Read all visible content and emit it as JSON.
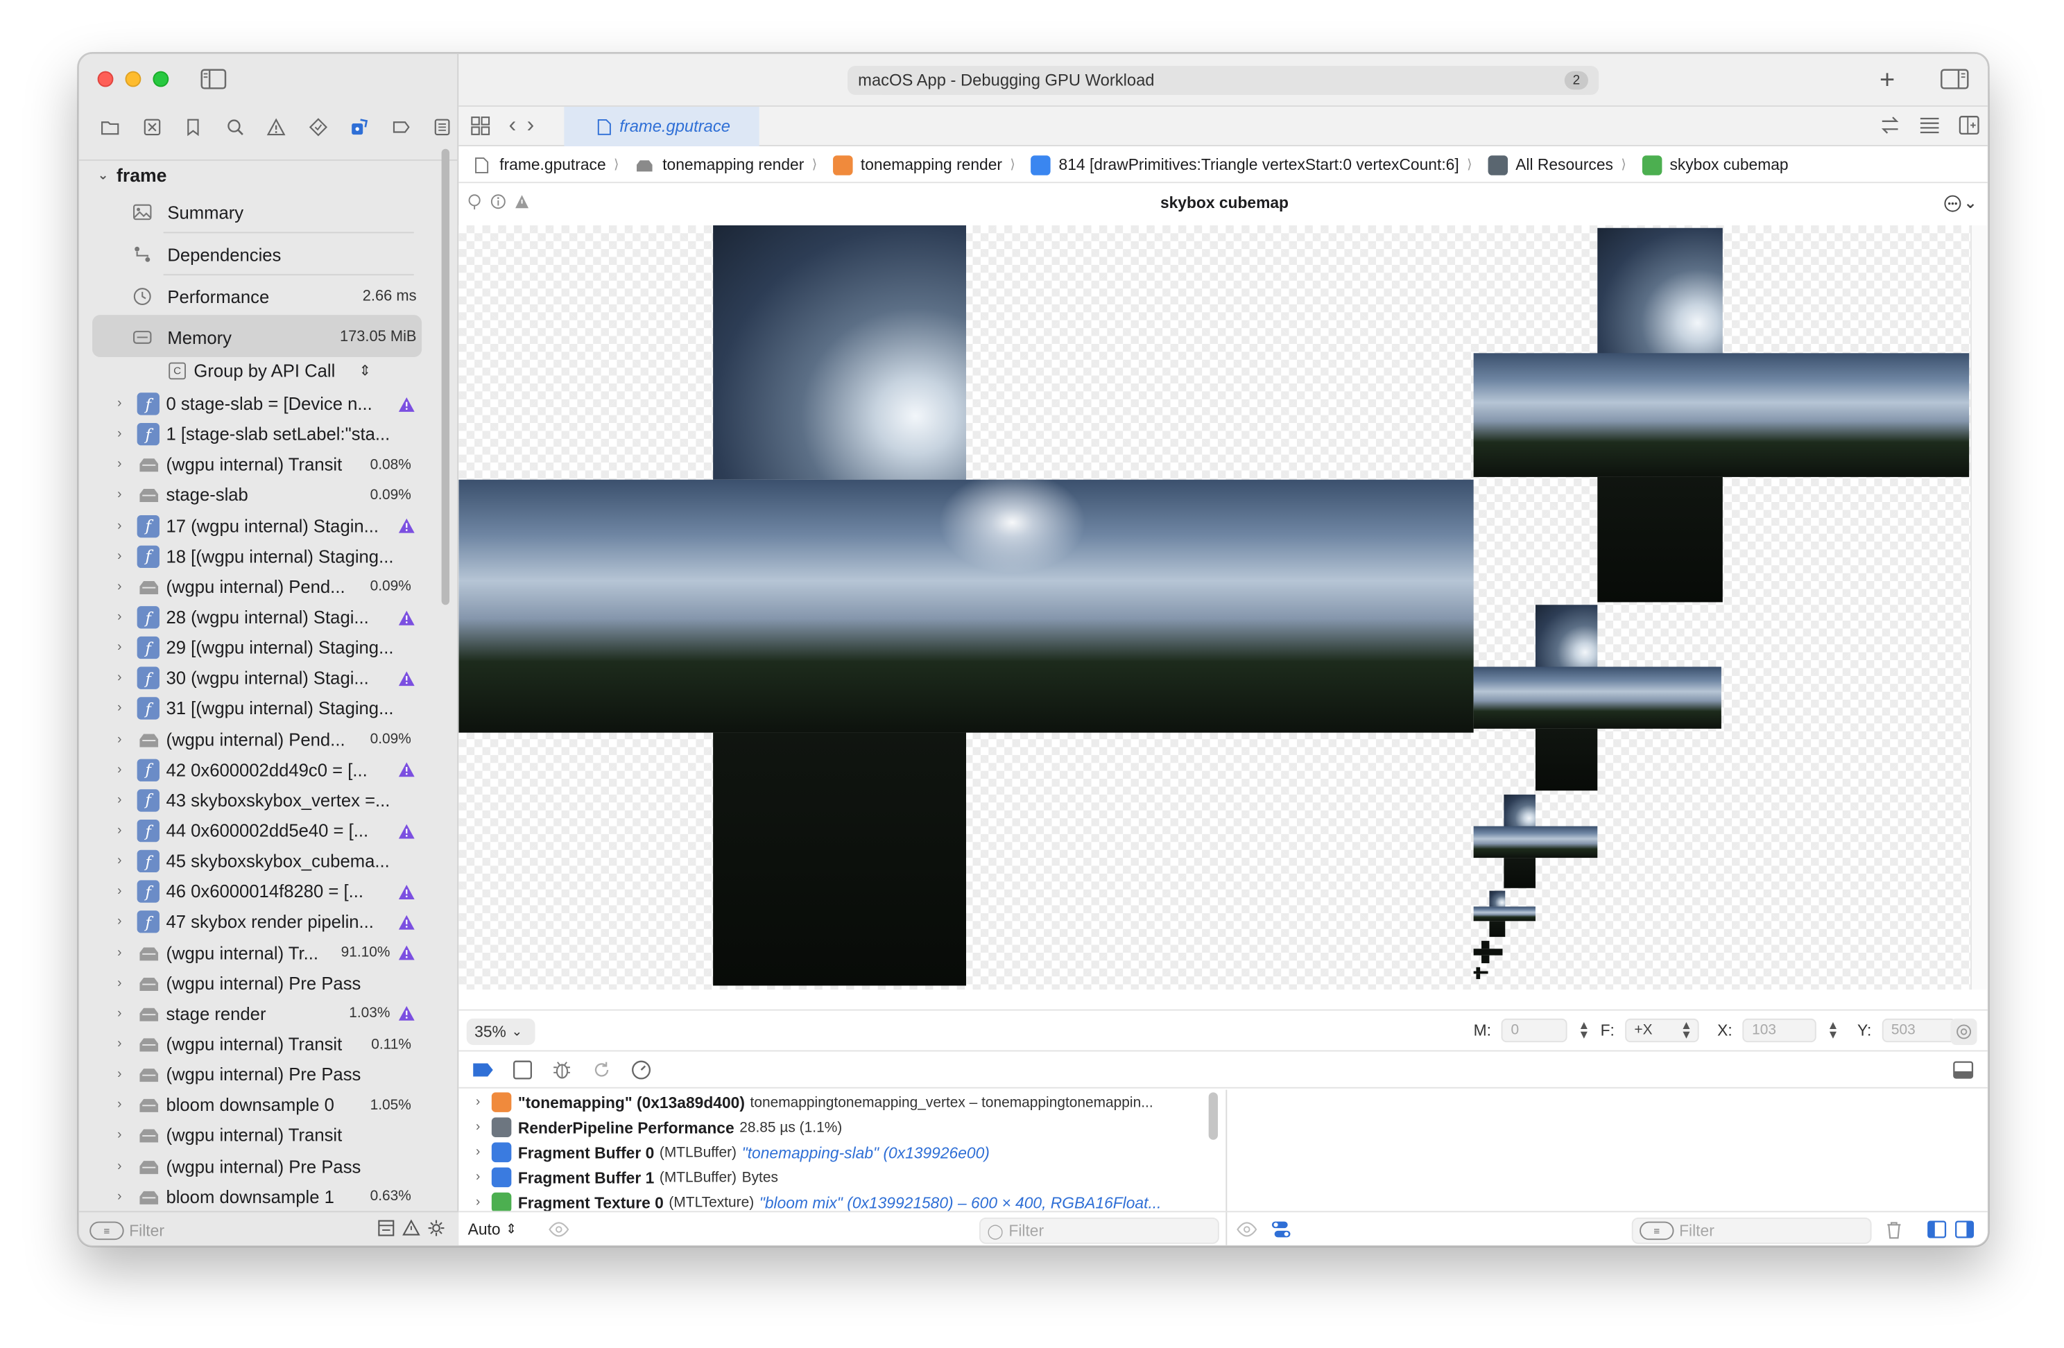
{
  "window": {
    "title": "macOS App - Debugging GPU Workload",
    "title_badge": "2"
  },
  "sidebar": {
    "root_label": "frame",
    "summary_items": [
      {
        "label": "Summary",
        "value": "",
        "icon": "photo-icon"
      },
      {
        "label": "Dependencies",
        "value": "",
        "icon": "dependencies-icon"
      },
      {
        "label": "Performance",
        "value": "2.66 ms",
        "icon": "clock-icon"
      },
      {
        "label": "Memory",
        "value": "173.05 MiB",
        "icon": "memory-icon"
      }
    ],
    "group_by": "Group by API Call",
    "group_box_letter": "C",
    "calls": [
      {
        "label": "0 stage-slab = [Device n...",
        "kind": "fn",
        "pct": "",
        "warn": true
      },
      {
        "label": "1 [stage-slab setLabel:\"sta...",
        "kind": "fn",
        "pct": "",
        "warn": false
      },
      {
        "label": "(wgpu internal) Transit",
        "kind": "enc",
        "pct": "0.08%",
        "warn": false
      },
      {
        "label": "stage-slab",
        "kind": "enc",
        "pct": "0.09%",
        "warn": false
      },
      {
        "label": "17 (wgpu internal) Stagin...",
        "kind": "fn",
        "pct": "",
        "warn": true
      },
      {
        "label": "18 [(wgpu internal) Staging...",
        "kind": "fn",
        "pct": "",
        "warn": false
      },
      {
        "label": "(wgpu internal) Pend...",
        "kind": "enc",
        "pct": "0.09%",
        "warn": false
      },
      {
        "label": "28 (wgpu internal) Stagi...",
        "kind": "fn",
        "pct": "",
        "warn": true
      },
      {
        "label": "29 [(wgpu internal) Staging...",
        "kind": "fn",
        "pct": "",
        "warn": false
      },
      {
        "label": "30 (wgpu internal) Stagi...",
        "kind": "fn",
        "pct": "",
        "warn": true
      },
      {
        "label": "31 [(wgpu internal) Staging...",
        "kind": "fn",
        "pct": "",
        "warn": false
      },
      {
        "label": "(wgpu internal) Pend...",
        "kind": "enc",
        "pct": "0.09%",
        "warn": false
      },
      {
        "label": "42 0x600002dd49c0 = [...",
        "kind": "fn",
        "pct": "",
        "warn": true
      },
      {
        "label": "43 skyboxskybox_vertex =...",
        "kind": "fn",
        "pct": "",
        "warn": false
      },
      {
        "label": "44 0x600002dd5e40 = [...",
        "kind": "fn",
        "pct": "",
        "warn": true
      },
      {
        "label": "45 skyboxskybox_cubema...",
        "kind": "fn",
        "pct": "",
        "warn": false
      },
      {
        "label": "46 0x6000014f8280 = [...",
        "kind": "fn",
        "pct": "",
        "warn": true
      },
      {
        "label": "47 skybox render pipelin...",
        "kind": "fn",
        "pct": "",
        "warn": true
      },
      {
        "label": "(wgpu internal) Tr...",
        "kind": "enc",
        "pct": "91.10%",
        "warn": true
      },
      {
        "label": "(wgpu internal) Pre Pass",
        "kind": "enc",
        "pct": "",
        "warn": false
      },
      {
        "label": "stage render",
        "kind": "enc",
        "pct": "1.03%",
        "warn": true
      },
      {
        "label": "(wgpu internal) Transit",
        "kind": "enc",
        "pct": "0.11%",
        "warn": false
      },
      {
        "label": "(wgpu internal) Pre Pass",
        "kind": "enc",
        "pct": "",
        "warn": false
      },
      {
        "label": "bloom downsample 0",
        "kind": "enc",
        "pct": "1.05%",
        "warn": false
      },
      {
        "label": "(wgpu internal) Transit",
        "kind": "enc",
        "pct": "",
        "warn": false
      },
      {
        "label": "(wgpu internal) Pre Pass",
        "kind": "enc",
        "pct": "",
        "warn": false
      },
      {
        "label": "bloom downsample 1",
        "kind": "enc",
        "pct": "0.63%",
        "warn": false
      }
    ],
    "filter_placeholder": "Filter"
  },
  "tabs": {
    "active_label": "frame.gputrace"
  },
  "jumpbar": [
    {
      "label": "frame.gputrace",
      "icon": "document-icon",
      "color": "#777777"
    },
    {
      "label": "tonemapping render",
      "icon": "encoder-icon",
      "color": "#8a8a8a"
    },
    {
      "label": "tonemapping render",
      "icon": "render-pass-icon",
      "color": "#f08a3c"
    },
    {
      "label": "814 [drawPrimitives:Triangle vertexStart:0 vertexCount:6]",
      "icon": "draw-call-icon",
      "color": "#3a86f0"
    },
    {
      "label": "All Resources",
      "icon": "resources-icon",
      "color": "#5a6670"
    },
    {
      "label": "skybox cubemap",
      "icon": "texture-icon",
      "color": "#4caf50"
    }
  ],
  "viewer": {
    "title": "skybox cubemap",
    "zoom": "35%",
    "fields": {
      "m_label": "M:",
      "m_value": "0",
      "f_label": "F:",
      "f_value": "+X",
      "x_label": "X:",
      "x_value": "103",
      "y_label": "Y:",
      "y_value": "503"
    }
  },
  "bindings": [
    {
      "title": "\"tonemapping\" (0x13a89d400)",
      "type": "tonemappingtonemapping_vertex – tonemappingtonemappin...",
      "link": "",
      "extra": "",
      "icon_color": "#f08a3c"
    },
    {
      "title": "RenderPipeline Performance",
      "type": "28.85 µs (1.1%)",
      "link": "",
      "extra": "",
      "icon_color": "#6d7680"
    },
    {
      "title": "Fragment Buffer 0",
      "type": "(MTLBuffer)",
      "link": "\"tonemapping-slab\" (0x139926e00)",
      "extra": "",
      "icon_color": "#3a7be0"
    },
    {
      "title": "Fragment Buffer 1",
      "type": "(MTLBuffer)",
      "link": "",
      "extra": "Bytes",
      "icon_color": "#3a7be0"
    },
    {
      "title": "Fragment Texture 0",
      "type": "(MTLTexture)",
      "link": "\"bloom mix\" (0x139921580) – 600 × 400, RGBA16Float...",
      "extra": "",
      "icon_color": "#4caf50"
    }
  ],
  "bottom": {
    "auto_label": "Auto",
    "filter_left": "Filter",
    "filter_right": "Filter"
  },
  "colors": {
    "accent": "#2f6fd6",
    "warning": "#7b4fe0",
    "sidebar_bg": "#e8e8e8"
  }
}
